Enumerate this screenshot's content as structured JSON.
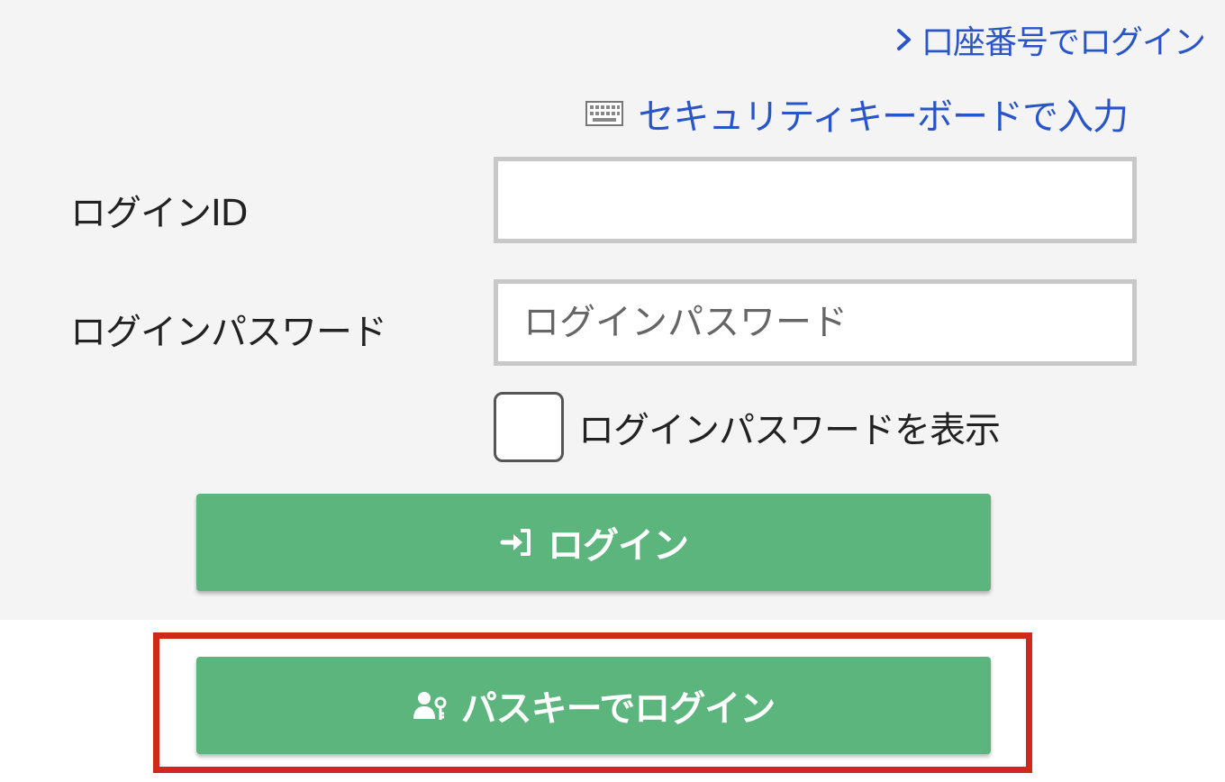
{
  "links": {
    "account_login": "口座番号でログイン",
    "security_keyboard": "セキュリティキーボードで入力"
  },
  "form": {
    "login_id_label": "ログインID",
    "login_id_value": "",
    "password_label": "ログインパスワード",
    "password_placeholder": "ログインパスワード",
    "show_password_label": "ログインパスワードを表示",
    "show_password_checked": false
  },
  "buttons": {
    "login": "ログイン",
    "passkey_login": "パスキーでログイン"
  },
  "icons": {
    "account_link": "chevron-right-icon",
    "keyboard": "keyboard-icon",
    "login": "login-arrow-icon",
    "passkey": "user-key-icon"
  },
  "colors": {
    "link": "#2a55c8",
    "button": "#5cb57c",
    "highlight": "#d0281d",
    "panel_bg": "#f4f4f4"
  }
}
